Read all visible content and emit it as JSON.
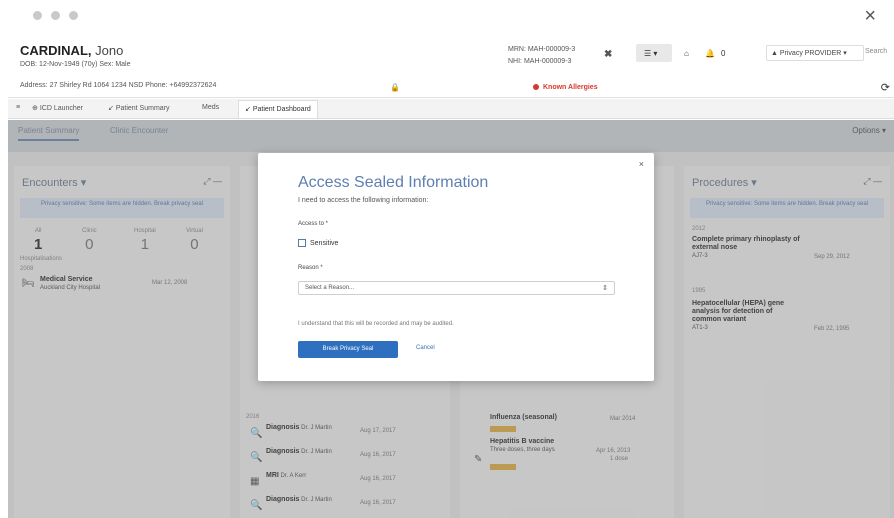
{
  "window": {
    "close_glyph": "×"
  },
  "banner": {
    "last_name": "CARDINAL,",
    "first_name": "Jono",
    "dob_line": "DOB: 12-Nov-1949 (70y)   Sex: Male",
    "address_line": "Address: 27 Shirley Rd 1064 1234 NSD   Phone: +64992372624",
    "mrn_line1": "MRN: MAH-000009-3",
    "mrn_line2": "NHI: MAH-000009-3",
    "mrn_close": "✖",
    "allergies": "Known Allergies",
    "notif_count": "0",
    "privacy_button": "▲ Privacy PROVIDER ▾",
    "search_placeholder": "Search"
  },
  "activity_tabs": [
    {
      "label": "ICD Launcher"
    },
    {
      "label": "Patient Summary"
    },
    {
      "label": "Meds"
    },
    {
      "label": "Patient Dashboard"
    }
  ],
  "sub_tabs": [
    {
      "label": "Patient Summary"
    },
    {
      "label": "Clinic Encounter"
    }
  ],
  "sub_right": "Options ▾",
  "encounters": {
    "title": "Encounters ▾",
    "sealed_text": "Privacy sensitive: Some items are hidden. Break privacy seal",
    "stats": [
      {
        "label": "All",
        "value": "1"
      },
      {
        "label": "Clinic",
        "value": "0"
      },
      {
        "label": "Hospital",
        "value": "1"
      },
      {
        "label": "Virtual",
        "value": "0"
      }
    ],
    "section_label": "Hospitalisations",
    "year_label": "2008",
    "entry_title": "Medical Service",
    "entry_sub": "Auckland City Hospital",
    "entry_date": "Mar 12, 2008"
  },
  "middle_list": [
    {
      "title": "Diagnosis",
      "sub": "Dr. J Martin",
      "date": "Aug 17, 2017"
    },
    {
      "title": "Diagnosis",
      "sub": "Dr. J Martin",
      "date": "Aug 16, 2017"
    },
    {
      "title": "MRI",
      "sub": "Dr. A Kerr",
      "date": "Aug 16, 2017"
    },
    {
      "title": "Diagnosis",
      "sub": "Dr. J Martin",
      "date": "Aug 16, 2017"
    }
  ],
  "middle_year": "2016",
  "vaccine": {
    "title": "Hepatitis B vaccine",
    "sub": "Three doses, three days",
    "date": "Apr 16, 2013",
    "dose": "1 dose",
    "title_top": "Influenza (seasonal)",
    "date_top": "Mar 2014"
  },
  "procedures": {
    "title": "Procedures ▾",
    "sealed_text": "Privacy sensitive: Some items are hidden. Break privacy seal",
    "year1": "2012",
    "p1_title": "Complete primary rhinoplasty of external nose",
    "p1_code": "AJ7-3",
    "p1_date": "Sep 29, 2012",
    "year2": "1995",
    "p2_title": "Hepatocellular (HEPA) gene analysis for detection of common variant",
    "p2_code": "AT1-3",
    "p2_date": "Feb 22, 1995"
  },
  "modal": {
    "close": "×",
    "title": "Access Sealed Information",
    "subtitle": "I need to access the following information:",
    "access_to_label": "Access to *",
    "checkbox_label": "Sensitive",
    "reason_label": "Reason *",
    "reason_placeholder": "Select a Reason...",
    "ack_text": "I understand that this will be recorded and may be audited.",
    "primary_button": "Break Privacy Seal",
    "cancel_button": "Cancel"
  }
}
